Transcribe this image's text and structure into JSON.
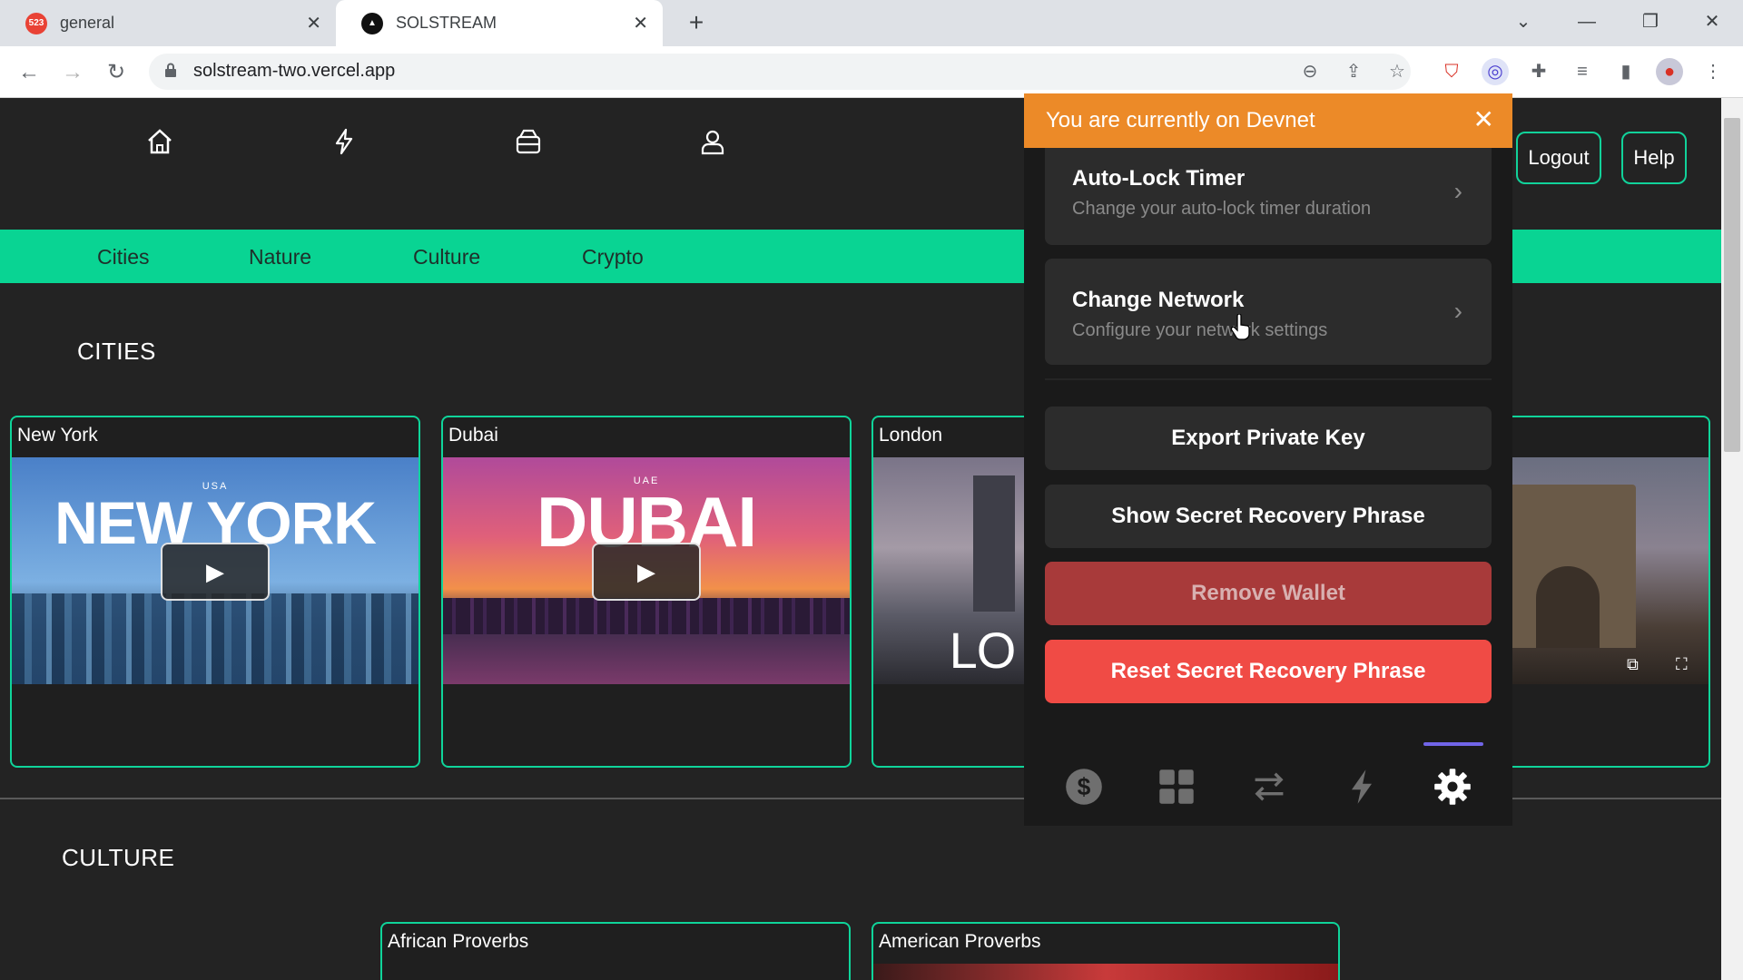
{
  "browser": {
    "tabs": [
      {
        "title": "general",
        "favicon_badge": "523",
        "active": false
      },
      {
        "title": "SOLSTREAM",
        "active": true
      }
    ],
    "url": "solstream-two.vercel.app"
  },
  "header": {
    "logout_label": "Logout",
    "help_label": "Help"
  },
  "categories": [
    "Cities",
    "Nature",
    "Culture",
    "Crypto"
  ],
  "sections": {
    "cities_title": "CITIES",
    "culture_title": "CULTURE"
  },
  "city_cards": [
    {
      "title": "New York",
      "thumb_small": "USA",
      "thumb_big": "NEW YORK"
    },
    {
      "title": "Dubai",
      "thumb_small": "UAE",
      "thumb_big": "DUBAI"
    },
    {
      "title": "London",
      "thumb_big": "LO"
    }
  ],
  "culture_cards": [
    {
      "title": "African Proverbs"
    },
    {
      "title": "American Proverbs"
    }
  ],
  "wallet": {
    "banner": "You are currently on Devnet",
    "settings": [
      {
        "title": "Auto-Lock Timer",
        "subtitle": "Change your auto-lock timer duration"
      },
      {
        "title": "Change Network",
        "subtitle": "Configure your network settings"
      }
    ],
    "actions": [
      {
        "label": "Export Private Key",
        "color": "#2c2c2c",
        "text_color": "#ffffff"
      },
      {
        "label": "Show Secret Recovery Phrase",
        "color": "#2c2c2c",
        "text_color": "#ffffff"
      },
      {
        "label": "Remove Wallet",
        "color": "#a83a3a",
        "text_color": "#d8b0b0"
      },
      {
        "label": "Reset Secret Recovery Phrase",
        "color": "#f04b45",
        "text_color": "#ffffff"
      }
    ],
    "footer_tabs": [
      "dollar-icon",
      "grid-icon",
      "swap-icon",
      "bolt-icon",
      "gear-icon"
    ],
    "active_tab": "gear-icon"
  },
  "colors": {
    "accent_green": "#09d493",
    "banner_orange": "#ec8a28",
    "active_tab_indicator": "#7165e8"
  }
}
